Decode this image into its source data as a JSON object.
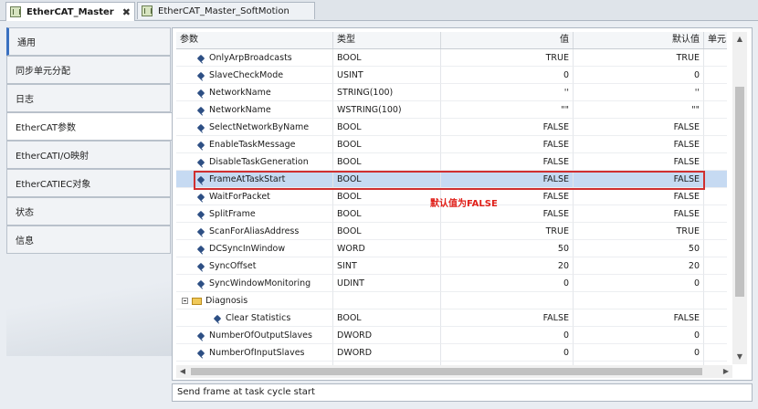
{
  "tabs": [
    {
      "label": "EtherCAT_Master",
      "close": "✖"
    },
    {
      "label": "EtherCAT_Master_SoftMotion"
    }
  ],
  "sidebar": {
    "items": [
      {
        "label": "通用"
      },
      {
        "label": "同步单元分配"
      },
      {
        "label": "日志"
      },
      {
        "label": "EtherCAT参数"
      },
      {
        "label": "EtherCATI/O映射"
      },
      {
        "label": "EtherCATIEC对象"
      },
      {
        "label": "状态"
      },
      {
        "label": "信息"
      }
    ]
  },
  "grid": {
    "headers": {
      "param": "参数",
      "type": "类型",
      "value": "值",
      "default": "默认值",
      "unit": "单元"
    },
    "rows": [
      {
        "name": "OnlyArpBroadcasts",
        "type": "BOOL",
        "value": "TRUE",
        "default": "TRUE"
      },
      {
        "name": "SlaveCheckMode",
        "type": "USINT",
        "value": "0",
        "default": "0"
      },
      {
        "name": "NetworkName",
        "type": "STRING(100)",
        "value": "''",
        "default": "''"
      },
      {
        "name": "NetworkName",
        "type": "WSTRING(100)",
        "value": "\"\"",
        "default": "\"\""
      },
      {
        "name": "SelectNetworkByName",
        "type": "BOOL",
        "value": "FALSE",
        "default": "FALSE"
      },
      {
        "name": "EnableTaskMessage",
        "type": "BOOL",
        "value": "FALSE",
        "default": "FALSE"
      },
      {
        "name": "DisableTaskGeneration",
        "type": "BOOL",
        "value": "FALSE",
        "default": "FALSE"
      },
      {
        "name": "FrameAtTaskStart",
        "type": "BOOL",
        "value": "FALSE",
        "default": "FALSE"
      },
      {
        "name": "WaitForPacket",
        "type": "BOOL",
        "value": "FALSE",
        "default": "FALSE"
      },
      {
        "name": "SplitFrame",
        "type": "BOOL",
        "value": "FALSE",
        "default": "FALSE"
      },
      {
        "name": "ScanForAliasAddress",
        "type": "BOOL",
        "value": "TRUE",
        "default": "TRUE"
      },
      {
        "name": "DCSyncInWindow",
        "type": "WORD",
        "value": "50",
        "default": "50"
      },
      {
        "name": "SyncOffset",
        "type": "SINT",
        "value": "20",
        "default": "20"
      },
      {
        "name": "SyncWindowMonitoring",
        "type": "UDINT",
        "value": "0",
        "default": "0"
      },
      {
        "name": "Diagnosis",
        "type": "",
        "value": "",
        "default": ""
      },
      {
        "name": "Clear Statistics",
        "type": "BOOL",
        "value": "FALSE",
        "default": "FALSE"
      },
      {
        "name": "NumberOfOutputSlaves",
        "type": "DWORD",
        "value": "0",
        "default": "0"
      },
      {
        "name": "NumberOfInputSlaves",
        "type": "DWORD",
        "value": "0",
        "default": "0"
      },
      {
        "name": "",
        "type": "",
        "value": "",
        "default": ""
      }
    ]
  },
  "annotation": {
    "text": "默认值为FALSE"
  },
  "status": {
    "text": "Send frame at task cycle start"
  },
  "scroll": {
    "up": "▲",
    "down": "▼",
    "left": "◀",
    "right": "▶"
  }
}
